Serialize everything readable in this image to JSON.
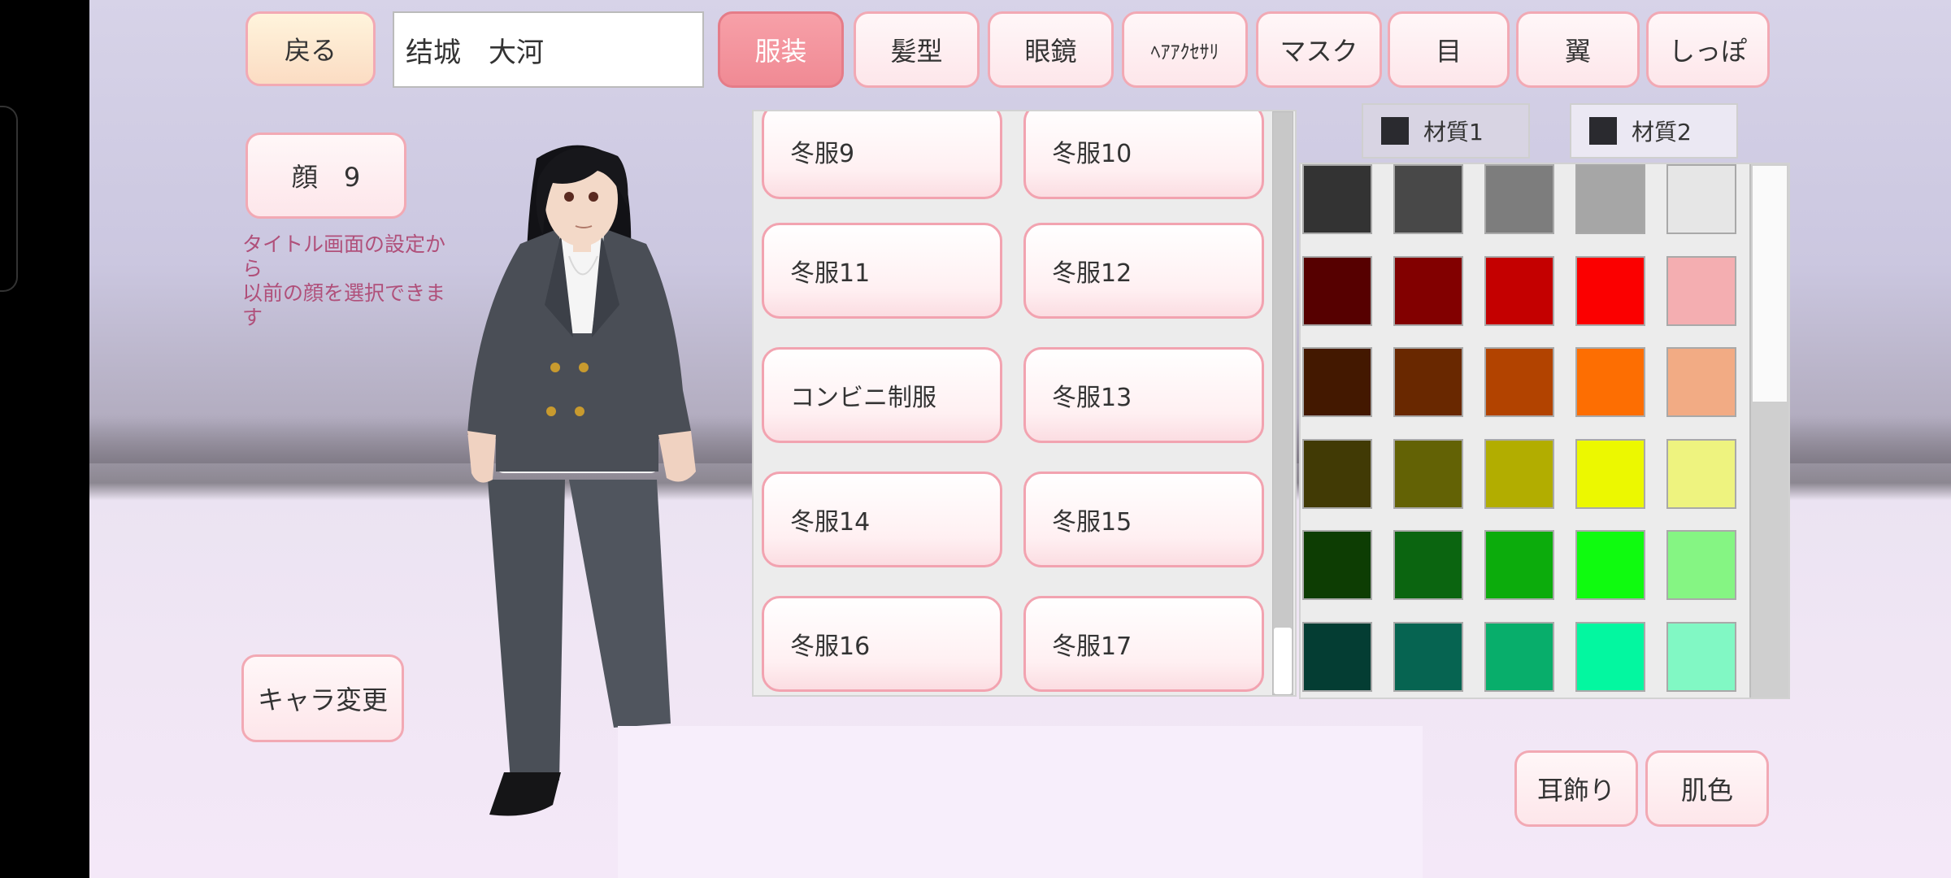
{
  "top_bar": {
    "back_label": "戻る",
    "character_name": "结城　大河",
    "categories": [
      {
        "label": "服装",
        "active": true
      },
      {
        "label": "髪型",
        "active": false
      },
      {
        "label": "眼鏡",
        "active": false
      },
      {
        "label": "ﾍｱｱｸｾｻﾘ",
        "active": false
      },
      {
        "label": "マスク",
        "active": false
      },
      {
        "label": "目",
        "active": false
      },
      {
        "label": "翼",
        "active": false
      },
      {
        "label": "しっぽ",
        "active": false
      }
    ]
  },
  "left_panel": {
    "face_label": "顔　9",
    "note": "タイトル画面の設定から\n以前の顔を選択できます",
    "change_character_label": "キャラ変更"
  },
  "costumes": [
    "冬服9",
    "冬服10",
    "冬服11",
    "冬服12",
    "コンビニ制服",
    "冬服13",
    "冬服14",
    "冬服15",
    "冬服16",
    "冬服17"
  ],
  "materials": {
    "tab1_label": "材質1",
    "tab2_label": "材質2",
    "current_color": "#2a2a2f"
  },
  "palette": [
    [
      "#333333",
      "#484848",
      "#7d7d7d",
      "#a6a6a6",
      "#e6e6e6"
    ],
    [
      "#560000",
      "#820000",
      "#c40000",
      "#fb0000",
      "#f4aeb1"
    ],
    [
      "#431800",
      "#692800",
      "#b24300",
      "#fd6e02",
      "#f2ab84"
    ],
    [
      "#413a05",
      "#636205",
      "#b2ad00",
      "#ecf800",
      "#eef37f"
    ],
    [
      "#0d3d03",
      "#0b6510",
      "#0cac0c",
      "#0ffb0f",
      "#85f583"
    ],
    [
      "#043d33",
      "#066451",
      "#08ae6b",
      "#03f7a0",
      "#81f8c4"
    ]
  ],
  "bottom_right": {
    "earring_label": "耳飾り",
    "skin_label": "肌色"
  }
}
